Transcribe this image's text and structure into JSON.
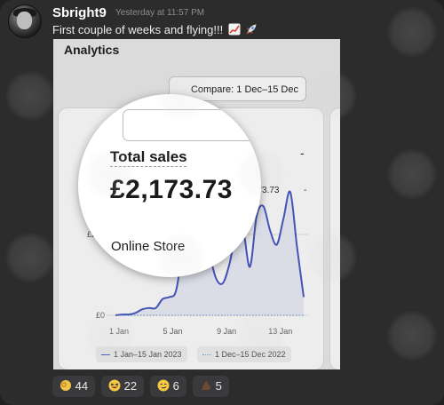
{
  "post": {
    "username": "Sbright9",
    "timestamp": "Yesterday at 11:57 PM",
    "message": "First couple of weeks and flying!!!",
    "message_emojis": [
      "chart-increasing-emoji",
      "rocket-emoji"
    ]
  },
  "screenshot": {
    "title": "Analytics",
    "compare_label": "Compare: 1 Dec–15 Dec 2022",
    "metric_label": "Total sales",
    "metric_value": "£2,173.73",
    "metric_value_secondary": "-",
    "breakdown": {
      "label": "Online Store",
      "value": "£2,173.73",
      "compare_value": "-"
    },
    "legend": [
      "1 Jan–15 Jan 2023",
      "1 Dec–15 Dec 2022"
    ]
  },
  "chart_data": {
    "type": "line",
    "x_ticks": [
      "1 Jan",
      "5 Jan",
      "9 Jan",
      "13 Jan"
    ],
    "y_ticks": [
      "£0",
      "£200"
    ],
    "ylim": [
      0,
      400
    ],
    "series": [
      {
        "name": "1 Jan–15 Jan 2023",
        "x": [
          0,
          0.5,
          1,
          1.5,
          2,
          2.5,
          3,
          3.5,
          4,
          4.5,
          5,
          5.5,
          6,
          6.5,
          7,
          7.5,
          8,
          8.5,
          9,
          9.5,
          10,
          10.5,
          11,
          11.5,
          12,
          12.5,
          13,
          13.5,
          14
        ],
        "y": [
          0,
          2,
          2,
          6,
          15,
          18,
          18,
          40,
          45,
          60,
          160,
          240,
          250,
          215,
          150,
          90,
          80,
          130,
          210,
          210,
          120,
          245,
          270,
          210,
          175,
          240,
          305,
          170,
          45
        ],
        "style": "solid"
      },
      {
        "name": "1 Dec–15 Dec 2022",
        "x": [
          0,
          14
        ],
        "y": [
          0,
          0
        ],
        "style": "dotted"
      }
    ]
  },
  "reactions": [
    {
      "emoji": "ok-hand-emoji",
      "count": "44"
    },
    {
      "emoji": "squinting-grin-emoji",
      "count": "22"
    },
    {
      "emoji": "smirk-emoji",
      "count": "6"
    },
    {
      "emoji": "flexed-biceps-emoji",
      "count": "5"
    }
  ],
  "colors": {
    "background": "#2c2c2d",
    "chart_line": "#4a5bc4",
    "compare_line": "#7ea6d6"
  }
}
